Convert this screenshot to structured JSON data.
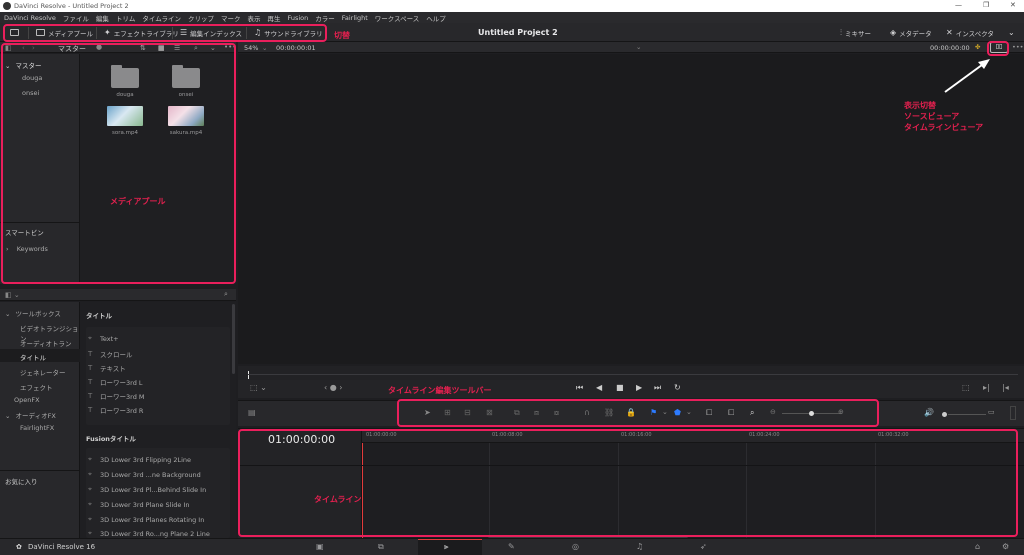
{
  "window": {
    "title": "DaVinci Resolve - Untitled Project 2",
    "controls": [
      "—",
      "❐",
      "✕"
    ]
  },
  "menu": [
    "DaVinci Resolve",
    "ファイル",
    "編集",
    "トリム",
    "タイムライン",
    "クリップ",
    "マーク",
    "表示",
    "再生",
    "Fusion",
    "カラー",
    "Fairlight",
    "ワークスペース",
    "ヘルプ"
  ],
  "toolbar": {
    "media_pool": "メディアプール",
    "effects_library": "エフェクトライブラリ",
    "edit_index": "編集インデックス",
    "sound_library": "サウンドライブラリ",
    "project_title": "Untitled Project 2",
    "mixer": "ミキサー",
    "metadata": "メタデータ",
    "inspector": "インスペクタ"
  },
  "media_pool": {
    "header": "マスター",
    "master": "マスター",
    "bins": [
      "douga",
      "onsei"
    ],
    "smart_bins": "スマートビン",
    "keywords": "Keywords",
    "clips": [
      {
        "name": "douga",
        "kind": "folder"
      },
      {
        "name": "onsei",
        "kind": "folder"
      },
      {
        "name": "sora.mp4",
        "kind": "video-sky"
      },
      {
        "name": "sakura.mp4",
        "kind": "video-sakura"
      }
    ]
  },
  "effects": {
    "toolbox": "ツールボックス",
    "categories": [
      "ビデオトランジション",
      "オーディオトランジ...",
      "タイトル",
      "ジェネレーター",
      "エフェクト"
    ],
    "openfx": "OpenFX",
    "audiofx": "オーディオFX",
    "fairlightfx": "FairlightFX",
    "favorites": "お気に入り",
    "titles_header": "タイトル",
    "titles": [
      "Text+",
      "スクロール",
      "テキスト",
      "ローワー3rd L",
      "ローワー3rd M",
      "ローワー3rd R"
    ],
    "fusion_header": "Fusionタイトル",
    "fusion_titles": [
      "3D Lower 3rd Flipping 2Line",
      "3D Lower 3rd ...ne Background",
      "3D Lower 3rd Pl...Behind Slide In",
      "3D Lower 3rd Plane Slide In",
      "3D Lower 3rd Planes Rotating In",
      "3D Lower 3rd Ro...ng Plane 2 Line"
    ]
  },
  "viewer": {
    "zoom": "54%",
    "timecode_left": "00:00:00:01",
    "timecode_right": "00:00:00:00"
  },
  "timeline": {
    "timecode": "01:00:00:00",
    "ruler": [
      "01:00:00:00",
      "01:00:08:00",
      "01:00:16:00",
      "01:00:24:00",
      "01:00:32:00"
    ]
  },
  "pages": {
    "app_name": "DaVinci Resolve 16"
  },
  "annotations": {
    "switch": "切替",
    "display_switch": "表示切替",
    "source_viewer": "ソースビューア",
    "timeline_viewer": "タイムラインビューア",
    "media_pool": "メディアプール",
    "edit_toolbar": "タイムライン編集ツールバー",
    "timeline": "タイムライン"
  },
  "colors": {
    "accent": "#ea1f5c",
    "playhead": "#e23b3b",
    "flag": "#2d7bff"
  }
}
